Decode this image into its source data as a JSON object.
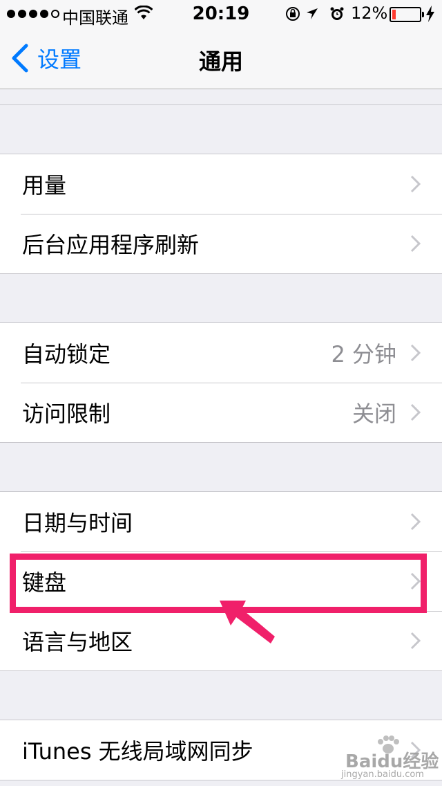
{
  "status_bar": {
    "carrier": "中国联通",
    "time": "20:19",
    "battery_percent": "12%",
    "battery_level": 0.12,
    "signal_bars_filled": 4,
    "signal_bars_total": 5
  },
  "nav": {
    "back_label": "设置",
    "title": "通用"
  },
  "groups": [
    {
      "rows": []
    },
    {
      "rows": [
        {
          "label": "用量",
          "value": ""
        },
        {
          "label": "后台应用程序刷新",
          "value": ""
        }
      ]
    },
    {
      "rows": [
        {
          "label": "自动锁定",
          "value": "2 分钟"
        },
        {
          "label": "访问限制",
          "value": "关闭"
        }
      ]
    },
    {
      "rows": [
        {
          "label": "日期与时间",
          "value": ""
        },
        {
          "label": "键盘",
          "value": ""
        },
        {
          "label": "语言与地区",
          "value": ""
        }
      ]
    },
    {
      "rows": [
        {
          "label": "iTunes 无线局域网同步",
          "value": ""
        }
      ]
    }
  ],
  "colors": {
    "accent": "#007aff",
    "highlight": "#f0206a",
    "battery_low": "#ff3b30"
  },
  "icons": [
    "wifi-icon",
    "orientation-lock-icon",
    "location-icon",
    "alarm-icon",
    "battery-icon",
    "charging-icon",
    "back-chevron-icon",
    "chevron-right-icon"
  ],
  "watermark": {
    "brand": "Baidu经验",
    "url": "jingyan.baidu.com"
  }
}
